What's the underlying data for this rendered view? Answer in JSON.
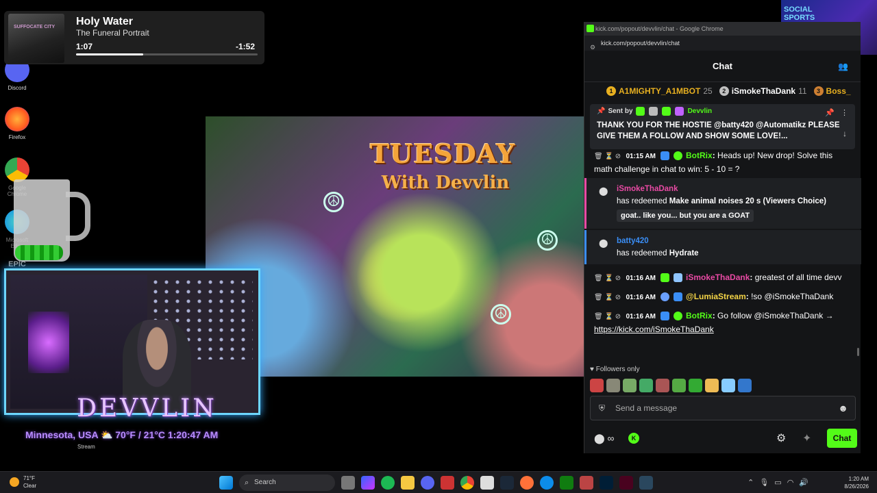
{
  "desktop": {
    "icons": [
      {
        "label": "Discord",
        "color": "#5865f2"
      },
      {
        "label": "Firefox",
        "color": "#ff7139"
      },
      {
        "label": "Google Chrome",
        "color": "#4285f4"
      },
      {
        "label": "Microsoft Edge",
        "color": "#0c8ce9"
      }
    ],
    "epic_label": "EPIC"
  },
  "media": {
    "title": "Holy Water",
    "artist": "The Funeral Portrait",
    "elapsed": "1:07",
    "remaining": "-1:52",
    "progress_fraction": 0.37,
    "album_text": "SUFFOCATE CITY"
  },
  "artwork": {
    "title": "TUESDAY",
    "subtitle": "With Devvlin"
  },
  "stream_overlay": {
    "name": "DEVVLIN",
    "location": "Minnesota, USA",
    "temperature": "70°F / 21°C",
    "clock": "1:20:47 AM",
    "stream_label": "Stream"
  },
  "thumbnail": {
    "text": "SOCIAL SPORTS GAMING"
  },
  "browser": {
    "window_title": "kick.com/popout/devvlin/chat - Google Chrome",
    "url": "kick.com/popout/devvlin/chat"
  },
  "chat": {
    "header": "Chat",
    "leaderboard": [
      {
        "rank": "1",
        "name": "A1MIGHTY_A1MBOT",
        "points": "25",
        "color": "#e8b020"
      },
      {
        "rank": "2",
        "name": "iSmokeThaDank",
        "points": "11",
        "color": "#c0c0c0"
      },
      {
        "rank": "3",
        "name": "Boss_",
        "points": "",
        "color": "#cd7f32"
      }
    ],
    "pinned": {
      "sent_by_label": "Sent by",
      "sender": "Devvlin",
      "text": "THANK YOU FOR THE HOSTIE @batty420 @Automatikz PLEASE GIVE THEM A FOLLOW AND SHOW SOME LOVE!..."
    },
    "messages": [
      {
        "time": "01:15 AM",
        "user": "BotRix",
        "user_color": "#53fc18",
        "text": "Heads up! New drop! Solve this math challenge in chat to win: 5 - 10 = ?"
      },
      {
        "time": "01:16 AM",
        "user": "iSmokeThaDank",
        "user_color": "#e94aa4",
        "text": "greatest of all time devv"
      },
      {
        "time": "01:16 AM",
        "user": "@LumiaStream",
        "user_color": "#f5d547",
        "text": "!so @iSmokeThaDank"
      },
      {
        "time": "01:16 AM",
        "user": "BotRix",
        "user_color": "#53fc18",
        "text": "Go follow @iSmokeThaDank →",
        "link": "https://kick.com/iSmokeThaDank"
      }
    ],
    "redemptions": [
      {
        "user": "iSmokeThaDank",
        "user_color": "#e94aa4",
        "accent": "#e94aa4",
        "prefix": "has redeemed",
        "reward": "Make animal noises 20 s (Viewers Choice)",
        "note": "goat.. like you... but you are a GOAT"
      },
      {
        "user": "batty420",
        "user_color": "#3a8ef6",
        "accent": "#3a8ef6",
        "prefix": "has redeemed",
        "reward": "Hydrate",
        "note": ""
      }
    ],
    "followers_only": "Followers only",
    "input_placeholder": "Send a message",
    "send_button": "Chat",
    "accent_color": "#53fc18"
  },
  "taskbar": {
    "weather_temp": "71°F",
    "weather_desc": "Clear",
    "search_placeholder": "Search",
    "time": "1:20 AM",
    "date": "8/26/2026"
  }
}
